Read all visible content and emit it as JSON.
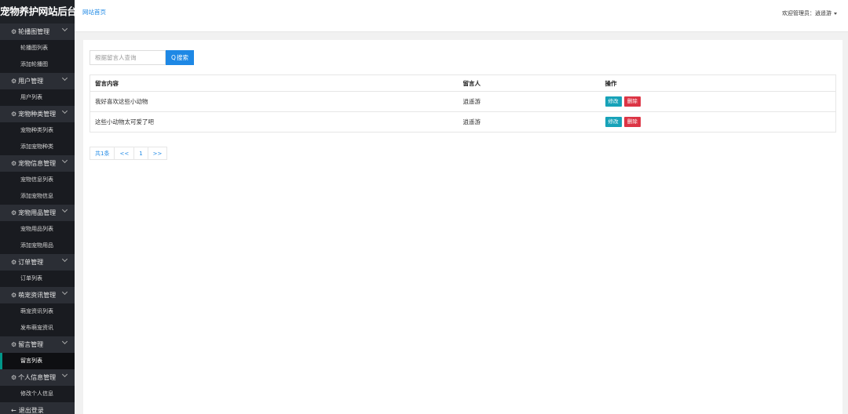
{
  "sidebar": {
    "title": "宠物养护网站后台",
    "groups": [
      {
        "label": "轮播图管理",
        "items": [
          "轮播图列表",
          "添加轮播图"
        ]
      },
      {
        "label": "用户管理",
        "items": [
          "用户列表"
        ]
      },
      {
        "label": "宠物种类管理",
        "items": [
          "宠物种类列表",
          "添加宠物种类"
        ]
      },
      {
        "label": "宠物信息管理",
        "items": [
          "宠物信息列表",
          "添加宠物信息"
        ]
      },
      {
        "label": "宠物用品管理",
        "items": [
          "宠物用品列表",
          "添加宠物用品"
        ]
      },
      {
        "label": "订单管理",
        "items": [
          "订单列表"
        ]
      },
      {
        "label": "萌宠资讯管理",
        "items": [
          "萌宠资讯列表",
          "发布萌宠资讯"
        ]
      },
      {
        "label": "留言管理",
        "items": [
          "留言列表"
        ]
      },
      {
        "label": "个人信息管理",
        "items": [
          "修改个人信息"
        ]
      }
    ],
    "logout": "退出登录"
  },
  "header": {
    "home_link": "网站首页",
    "user_greeting": "欢迎管理员：逍遥游"
  },
  "search": {
    "placeholder": "根据留言人查询",
    "button": "搜索"
  },
  "table": {
    "headers": [
      "留言内容",
      "留言人",
      "操作"
    ],
    "rows": [
      {
        "content": "我好喜欢这些小动物",
        "author": "逍遥游"
      },
      {
        "content": "这些小动物太可爱了吧",
        "author": "逍遥游"
      }
    ],
    "edit_label": "修改",
    "delete_label": "删除"
  },
  "pagination": {
    "total": "共1条",
    "prev": "<<",
    "page": "1",
    "next": ">>"
  }
}
